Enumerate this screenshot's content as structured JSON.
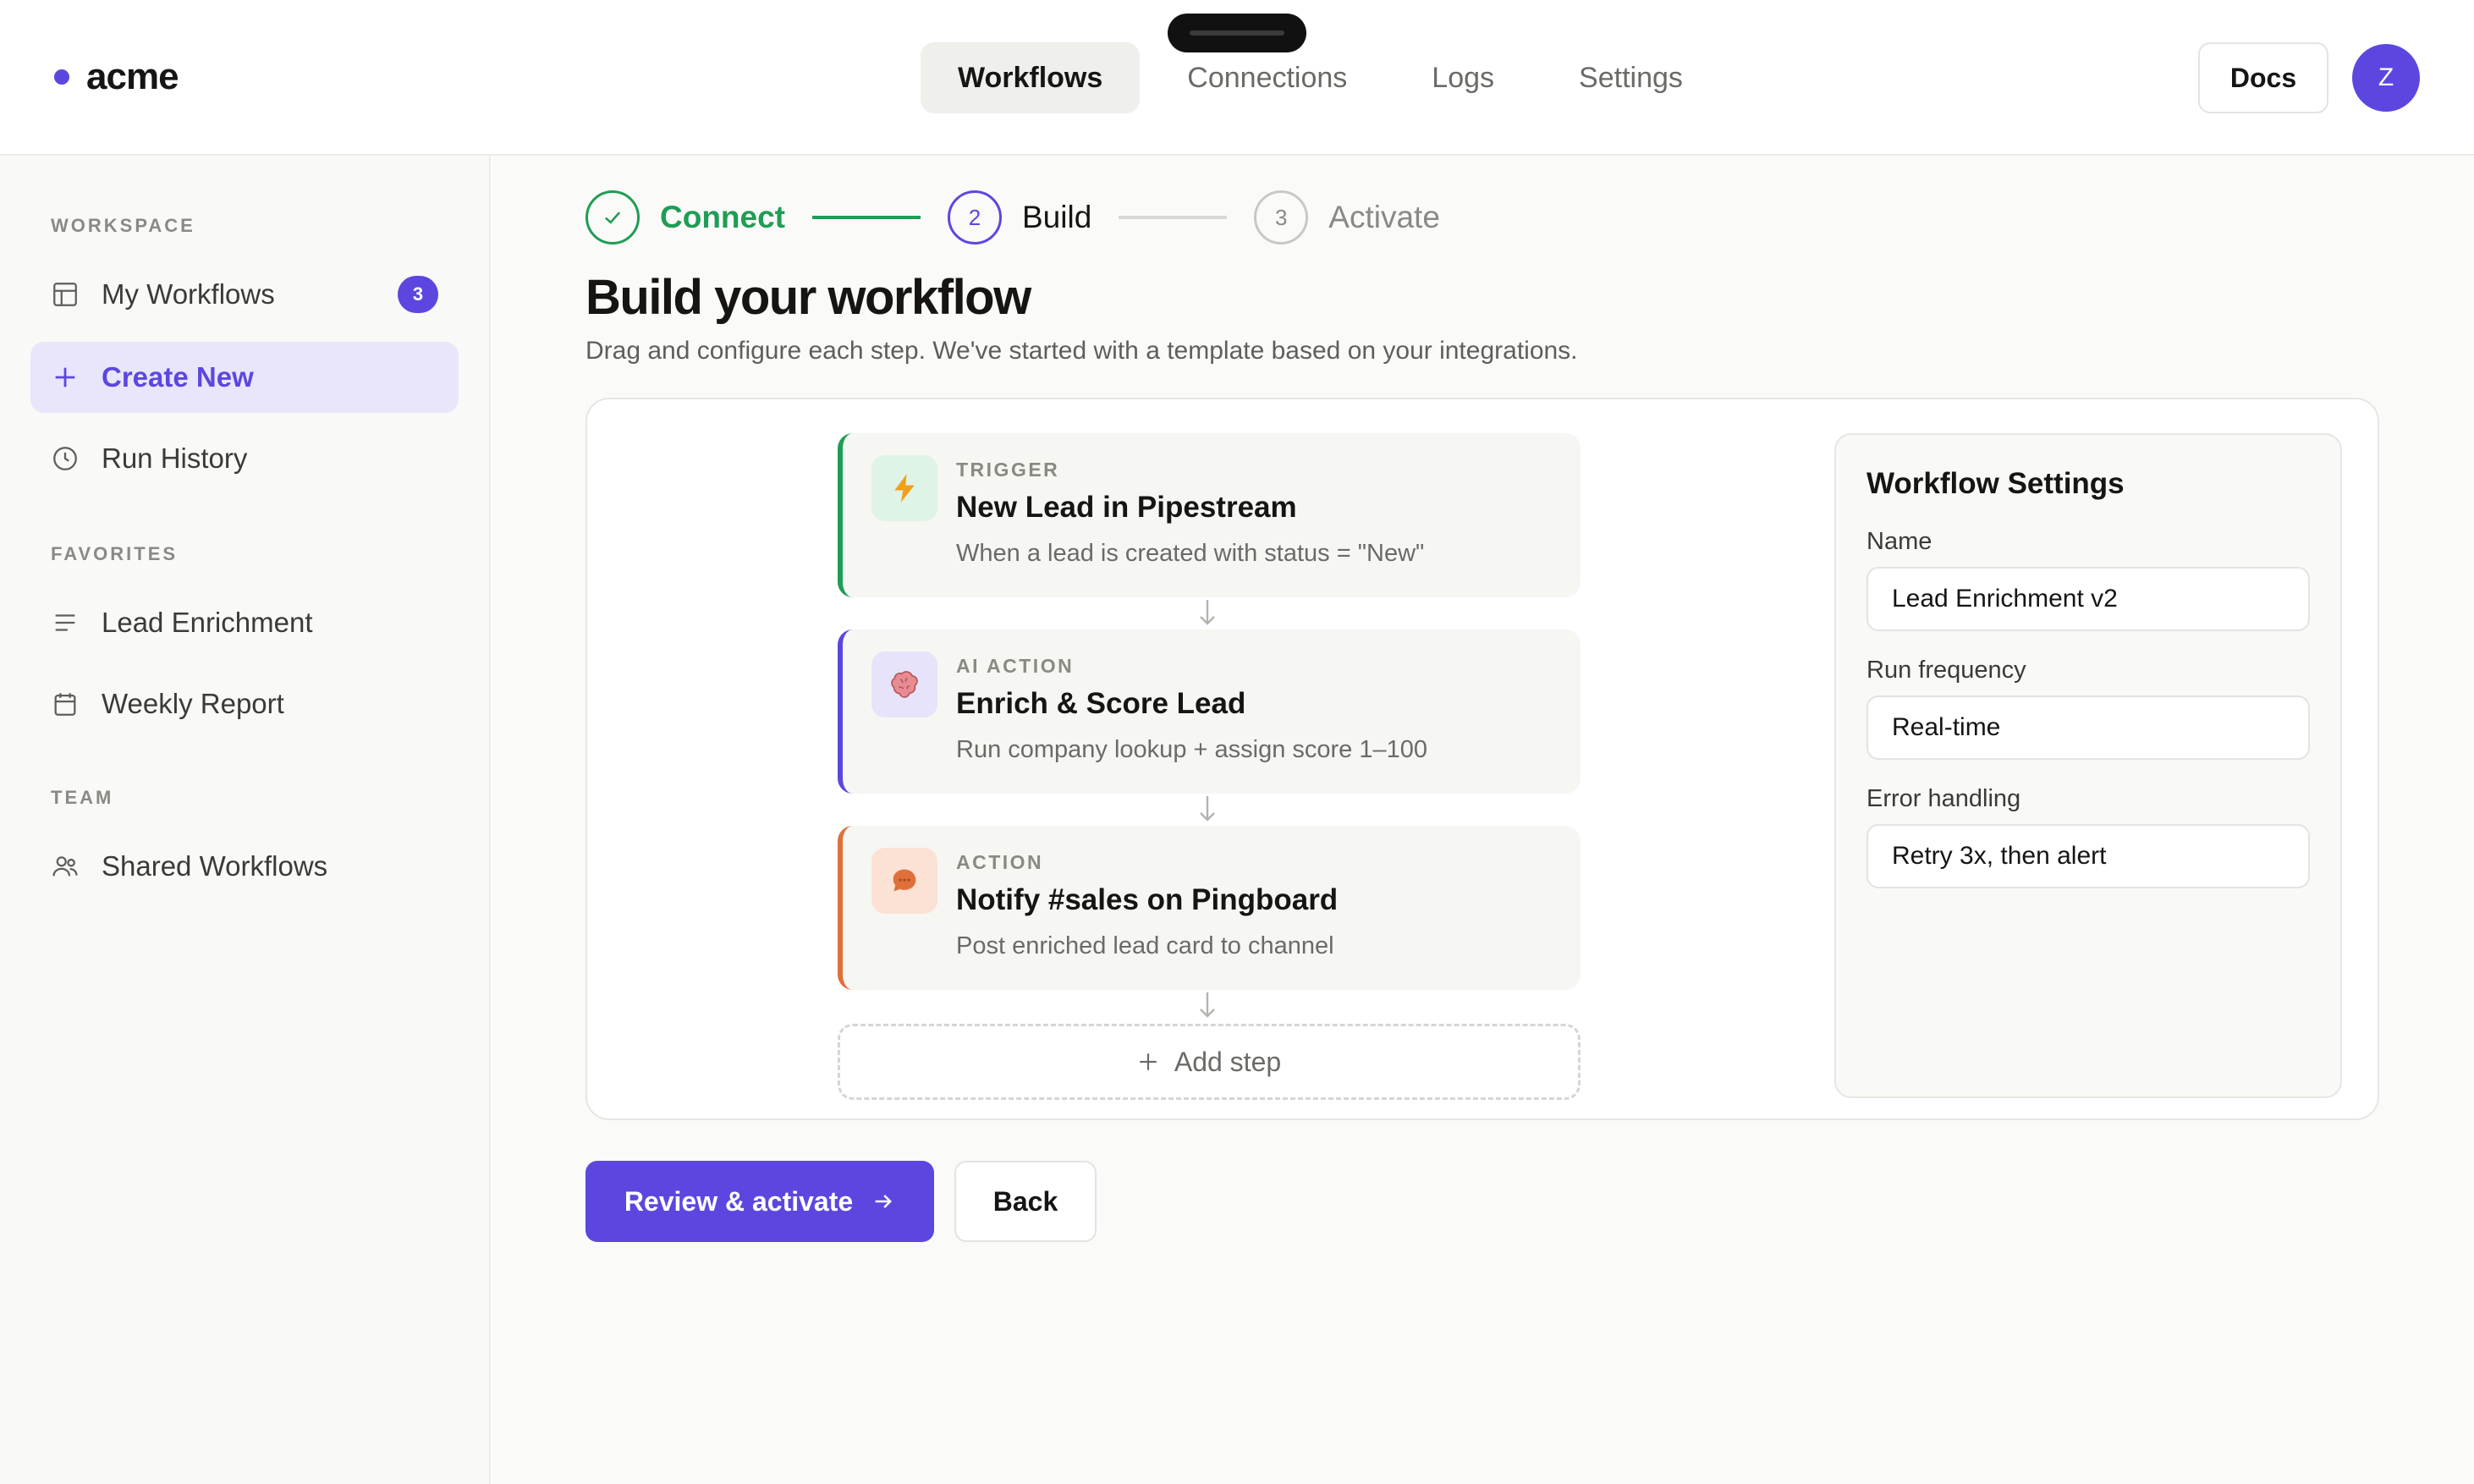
{
  "brand": {
    "name": "acme"
  },
  "nav": {
    "tabs": [
      {
        "label": "Workflows"
      },
      {
        "label": "Connections"
      },
      {
        "label": "Logs"
      },
      {
        "label": "Settings"
      }
    ]
  },
  "header": {
    "docs_label": "Docs",
    "avatar_initial": "Z"
  },
  "sidebar": {
    "sections": [
      {
        "label": "WORKSPACE"
      },
      {
        "label": "FAVORITES"
      },
      {
        "label": "TEAM"
      }
    ],
    "items": [
      {
        "label": "My Workflows",
        "badge": "3"
      },
      {
        "label": "Create New"
      },
      {
        "label": "Run History"
      },
      {
        "label": "Lead Enrichment"
      },
      {
        "label": "Weekly Report"
      },
      {
        "label": "Shared Workflows"
      }
    ]
  },
  "stepper": {
    "steps": [
      {
        "number": "1",
        "label": "Connect",
        "status": "done"
      },
      {
        "number": "2",
        "label": "Build",
        "status": "current"
      },
      {
        "number": "3",
        "label": "Activate",
        "status": "pending"
      }
    ]
  },
  "main": {
    "title": "Build your workflow",
    "subtitle": "Drag and configure each step. We've started with a template based on your integrations."
  },
  "workflow": {
    "steps": [
      {
        "kicker": "TRIGGER",
        "title": "New Lead in Pipestream",
        "description": "When a lead is created with status = \"New\"",
        "icon": "lightning-icon",
        "accent": "#1f9d55"
      },
      {
        "kicker": "AI ACTION",
        "title": "Enrich & Score Lead",
        "description": "Run company lookup + assign score 1–100",
        "icon": "brain-icon",
        "accent": "#5b47e0"
      },
      {
        "kicker": "ACTION",
        "title": "Notify #sales on Pingboard",
        "description": "Post enriched lead card to channel",
        "icon": "chat-bubble-icon",
        "accent": "#e0703a"
      }
    ],
    "add_step_label": "Add step"
  },
  "settings": {
    "title": "Workflow Settings",
    "fields": [
      {
        "label": "Name",
        "value": "Lead Enrichment v2"
      },
      {
        "label": "Run frequency",
        "value": "Real-time"
      },
      {
        "label": "Error handling",
        "value": "Retry 3x, then alert"
      }
    ]
  },
  "actions": {
    "primary_label": "Review & activate",
    "secondary_label": "Back"
  },
  "colors": {
    "accent": "#5b47e0",
    "success": "#1f9d55",
    "warning": "#e0703a"
  }
}
